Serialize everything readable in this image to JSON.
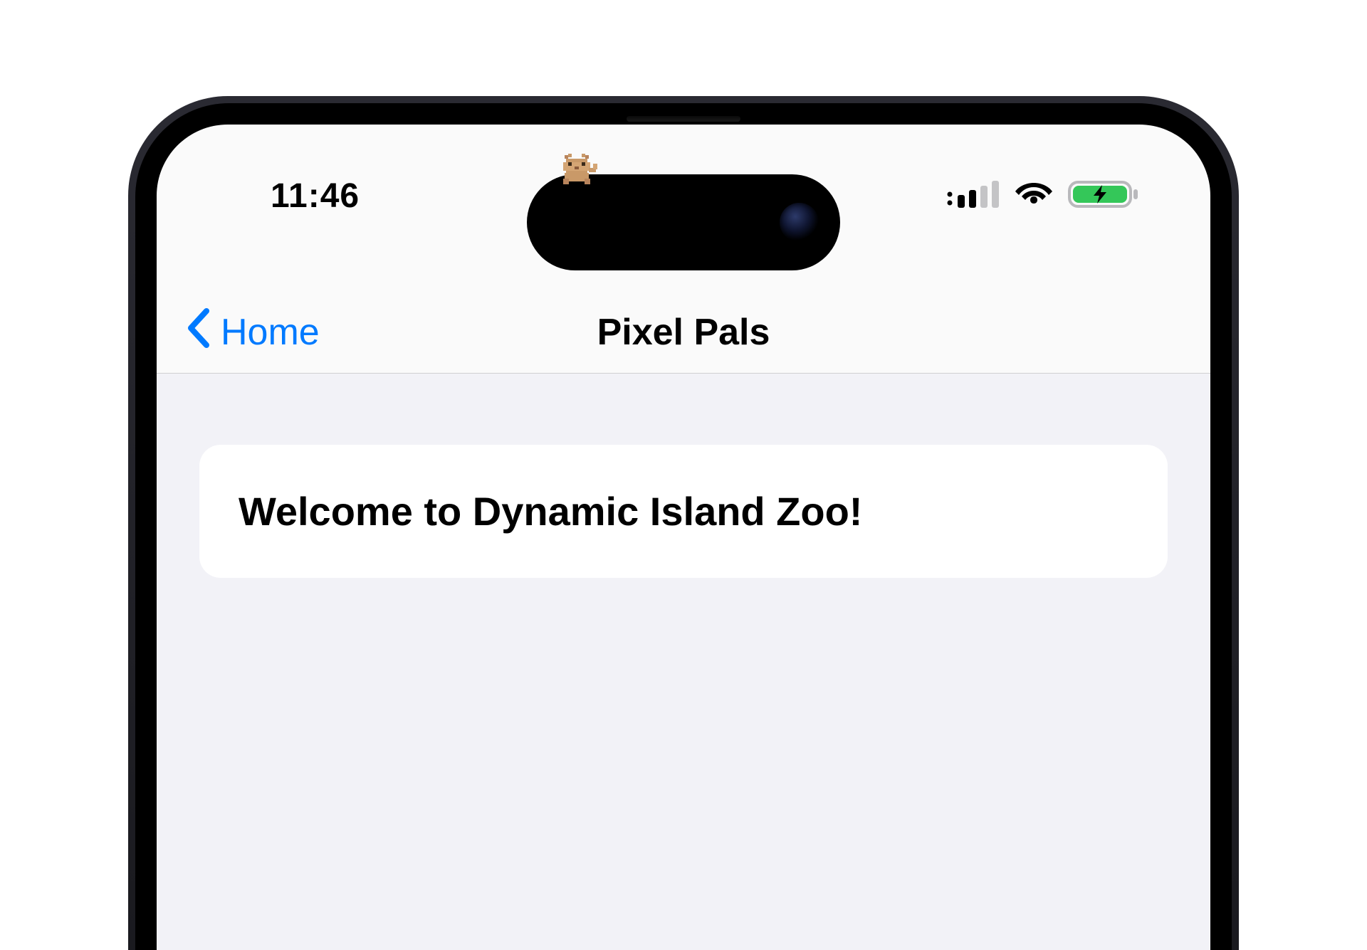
{
  "status_bar": {
    "time": "11:46",
    "cellular_bars_active": 2,
    "cellular_bars_total": 4,
    "wifi_active": true,
    "battery_charging": true,
    "battery_color": "#34c759"
  },
  "dynamic_island": {
    "pet_name": "pixel-cat"
  },
  "nav": {
    "back_label": "Home",
    "title": "Pixel Pals"
  },
  "content": {
    "heading": "Welcome to Dynamic Island Zoo!"
  },
  "colors": {
    "ios_blue": "#007aff",
    "ios_green": "#34c759",
    "bg_secondary": "#f2f2f7",
    "separator": "#d0d0d2"
  }
}
